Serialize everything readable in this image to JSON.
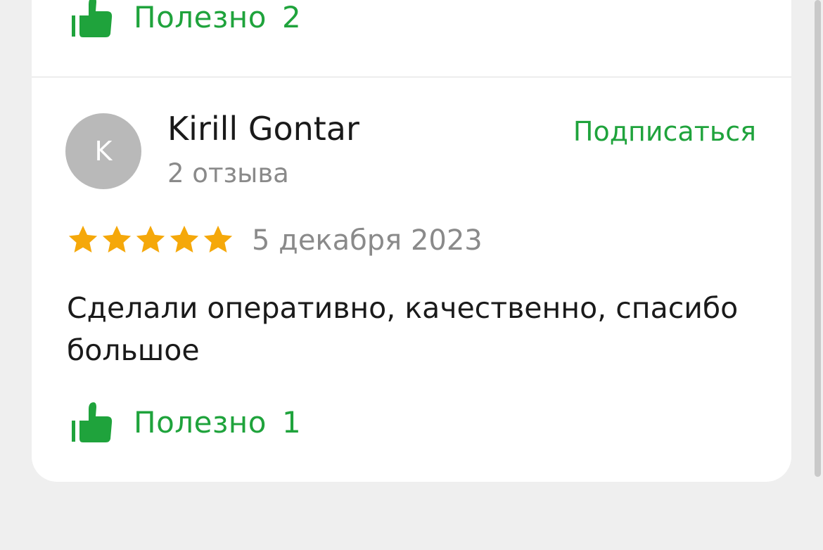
{
  "previous_review": {
    "helpful_label": "Полезно",
    "helpful_count": "2"
  },
  "review": {
    "avatar_letter": "K",
    "author_name": "Kirill Gontar",
    "review_count": "2 отзыва",
    "subscribe_label": "Подписаться",
    "rating": 5,
    "date": "5 декабря 2023",
    "text": "Сделали оперативно, качественно, спасибо большое",
    "helpful_label": "Полезно",
    "helpful_count": "1"
  },
  "colors": {
    "accent_green": "#1fa33c",
    "star_yellow": "#f5a80a",
    "avatar_gray": "#b9b9b9",
    "page_background": "#efefef"
  },
  "icons": [
    "thumbs-up-icon",
    "star-icon"
  ]
}
